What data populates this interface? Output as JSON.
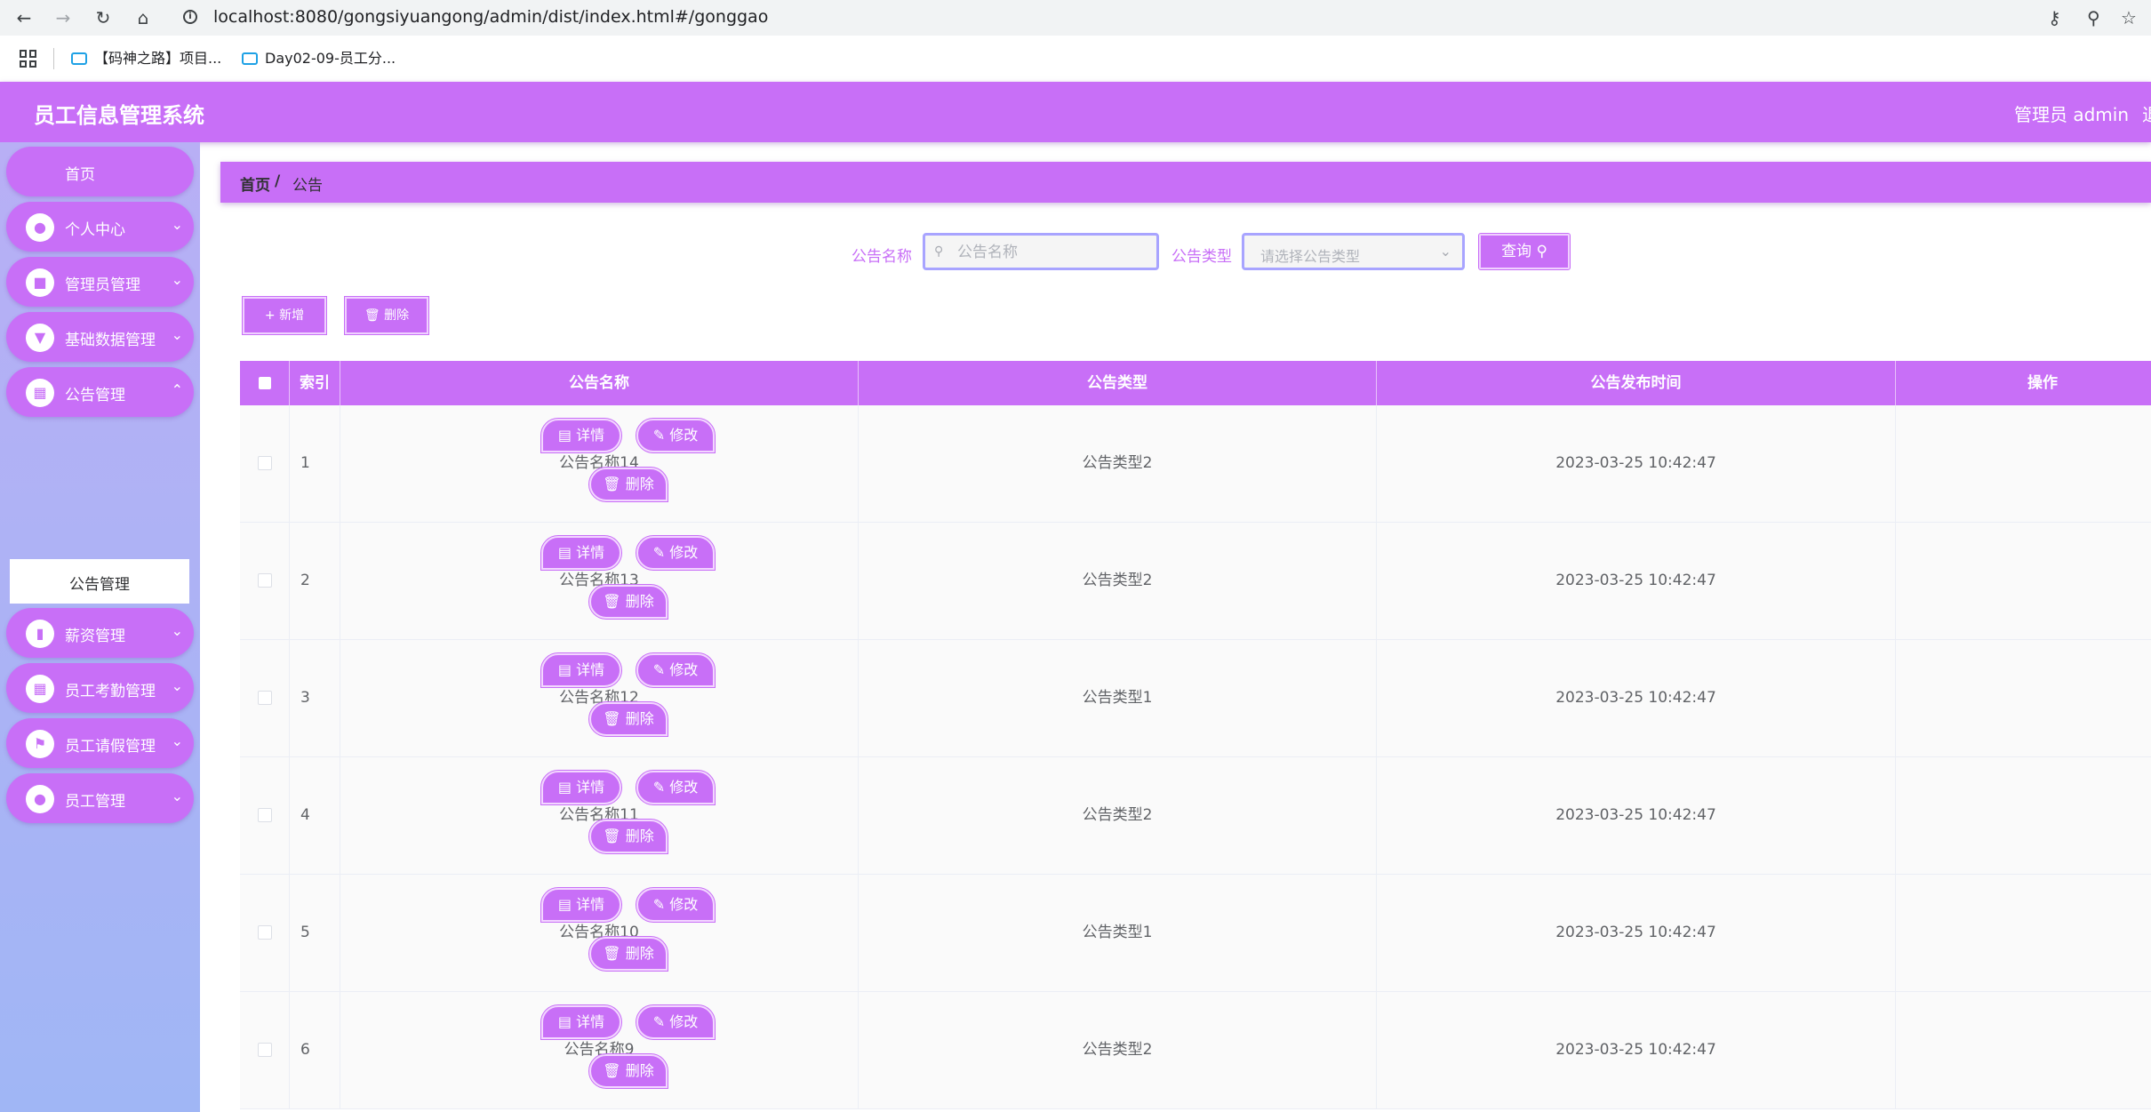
{
  "browser": {
    "url": "localhost:8080/gongsiyuangong/admin/dist/index.html#/gonggao",
    "bookmarks": [
      "【码神之路】项目...",
      "Day02-09-员工分..."
    ]
  },
  "header": {
    "title": "员工信息管理系统",
    "user": "管理员 admin",
    "logout": "退"
  },
  "sidebar": {
    "home": "首页",
    "items": [
      {
        "label": "个人中心",
        "icon": "user-icon"
      },
      {
        "label": "管理员管理",
        "icon": "admin-icon"
      },
      {
        "label": "基础数据管理",
        "icon": "data-icon"
      },
      {
        "label": "公告管理",
        "icon": "grid-icon"
      },
      {
        "label": "薪资管理",
        "icon": "chart-icon"
      },
      {
        "label": "员工考勤管理",
        "icon": "grid-icon"
      },
      {
        "label": "员工请假管理",
        "icon": "flag-icon"
      },
      {
        "label": "员工管理",
        "icon": "user-icon"
      }
    ],
    "submenu": "公告管理"
  },
  "breadcrumb": {
    "home": "首页",
    "separator": "/",
    "current": "公告"
  },
  "search": {
    "name_label": "公告名称",
    "name_placeholder": "公告名称",
    "type_label": "公告类型",
    "type_placeholder": "请选择公告类型",
    "query_button": "查询"
  },
  "actions": {
    "add": "新增",
    "delete": "删除"
  },
  "table": {
    "columns": [
      "索引",
      "公告名称",
      "公告类型",
      "公告发布时间",
      "操作"
    ],
    "rows": [
      {
        "index": "1",
        "name": "公告名称14",
        "type": "公告类型2",
        "time": "2023-03-25 10:42:47"
      },
      {
        "index": "2",
        "name": "公告名称13",
        "type": "公告类型2",
        "time": "2023-03-25 10:42:47"
      },
      {
        "index": "3",
        "name": "公告名称12",
        "type": "公告类型1",
        "time": "2023-03-25 10:42:47"
      },
      {
        "index": "4",
        "name": "公告名称11",
        "type": "公告类型2",
        "time": "2023-03-25 10:42:47"
      },
      {
        "index": "5",
        "name": "公告名称10",
        "type": "公告类型1",
        "time": "2023-03-25 10:42:47"
      },
      {
        "index": "6",
        "name": "公告名称9",
        "type": "公告类型2",
        "time": "2023-03-25 10:42:47"
      }
    ],
    "row_buttons": {
      "detail": "详情",
      "edit": "修改",
      "delete": "删除"
    }
  },
  "colors": {
    "accent": "#c86ff7",
    "sidebar_top": "#b8aff5",
    "sidebar_bottom": "#a0b6f5",
    "input_border": "#a8a4ff"
  }
}
